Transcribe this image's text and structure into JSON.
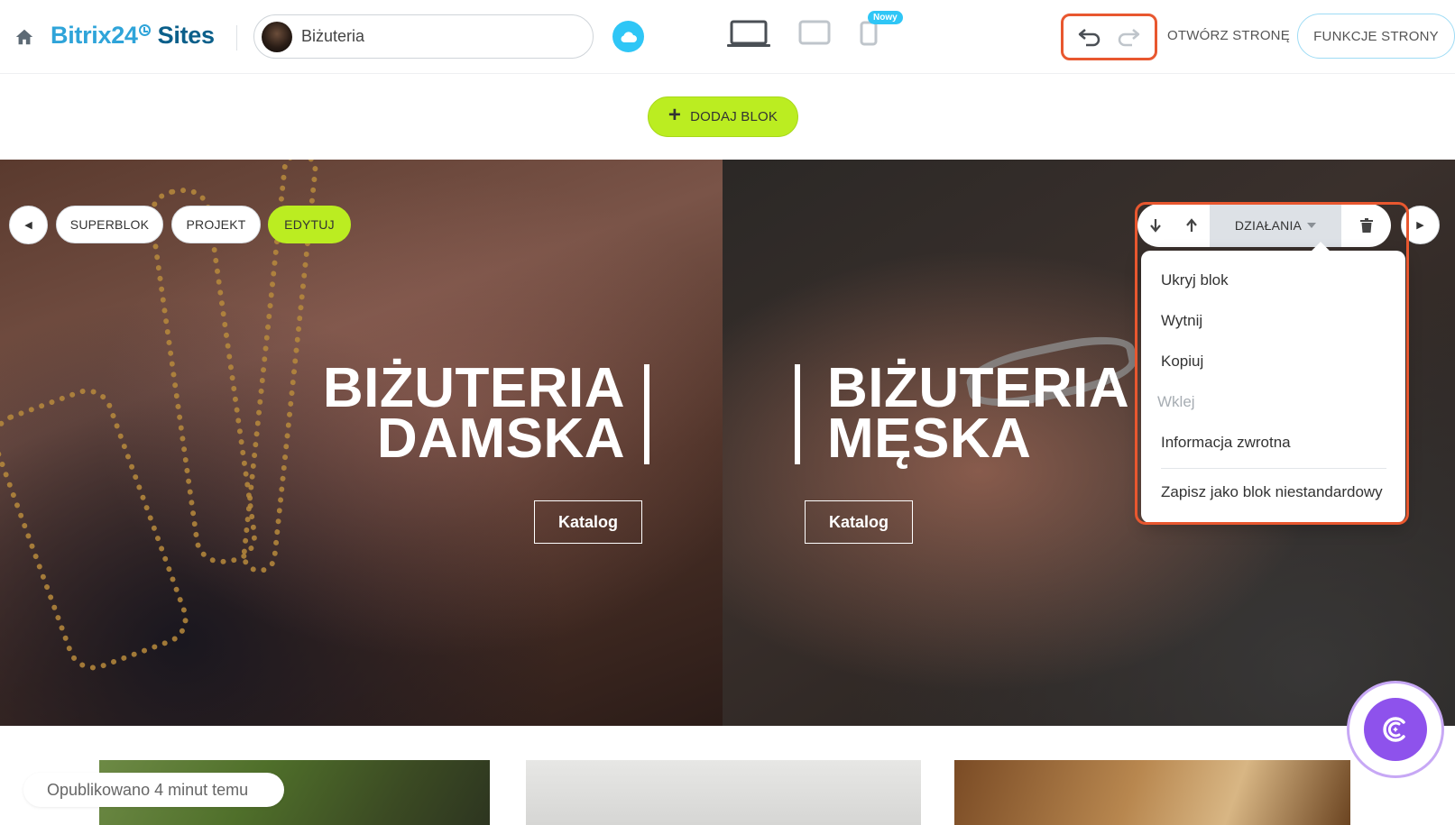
{
  "header": {
    "logo_brand": "Bitrix24",
    "logo_product": "Sites",
    "site_name": "Biżuteria",
    "new_badge": "Nowy",
    "open_page_label": "OTWÓRZ STRONĘ",
    "page_functions_label": "FUNKCJE STRONY"
  },
  "add_block_label": "DODAJ BLOK",
  "block_toolbar": {
    "superblock_label": "SUPERBLOK",
    "project_label": "PROJEKT",
    "edit_label": "EDYTUJ",
    "actions_label": "DZIAŁANIA"
  },
  "actions_menu": {
    "items": [
      {
        "label": "Ukryj blok",
        "disabled": false
      },
      {
        "label": "Wytnij",
        "disabled": false
      },
      {
        "label": "Kopiuj",
        "disabled": false
      },
      {
        "label": "Wklej",
        "disabled": true
      },
      {
        "label": "Informacja zwrotna",
        "disabled": false
      },
      {
        "label": "Zapisz jako blok niestandardowy",
        "disabled": false
      }
    ]
  },
  "hero": {
    "left": {
      "title_line1": "BIŻUTERIA",
      "title_line2": "DAMSKA",
      "button": "Katalog"
    },
    "right": {
      "title_line1": "BIŻUTERIA",
      "title_line2": "MĘSKA",
      "button": "Katalog"
    }
  },
  "status": {
    "published": "Opublikowano 4 minut temu"
  },
  "colors": {
    "accent_green": "#bbed21",
    "accent_blue": "#2fc6f6",
    "highlight_orange": "#e8572f",
    "copilot_purple": "#8e52ec"
  }
}
